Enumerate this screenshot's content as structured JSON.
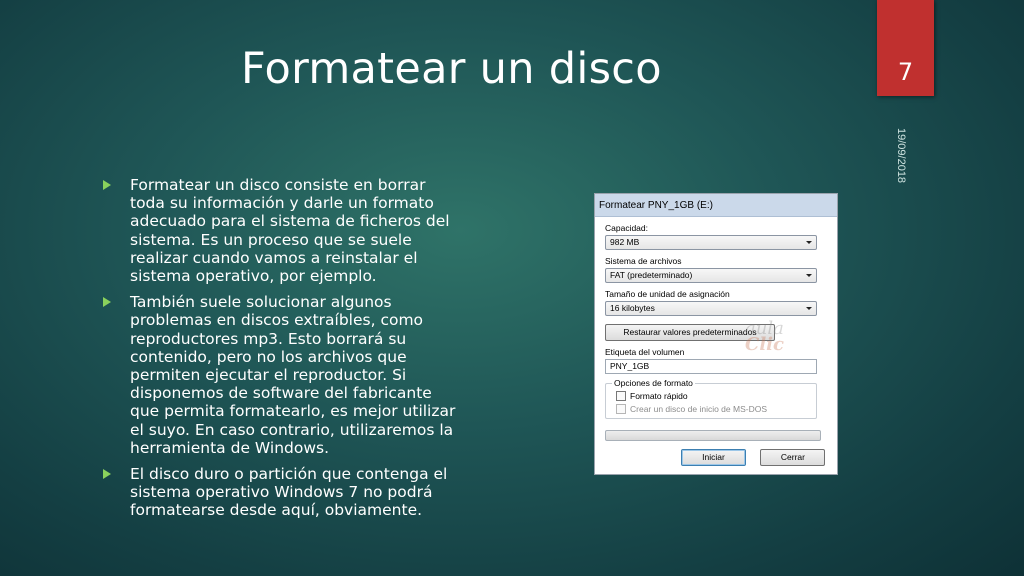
{
  "slide": {
    "title": "Formatear un disco",
    "page_number": "7",
    "date": "19/09/2018",
    "bullets": [
      "Formatear un disco consiste en borrar toda su información y darle un formato adecuado para el sistema de ficheros del sistema. Es un proceso que se suele realizar cuando vamos a reinstalar el sistema operativo, por ejemplo.",
      "También suele solucionar algunos problemas en discos extraíbles, como reproductores mp3. Esto borrará su contenido, pero no los archivos que permiten ejecutar el reproductor. Si disponemos de software del fabricante que permita formatearlo, es mejor utilizar el suyo. En caso contrario, utilizaremos la herramienta de Windows.",
      "El disco duro o partición que contenga el sistema operativo Windows 7 no podrá formatearse desde aquí, obviamente."
    ],
    "colors": {
      "accent_badge": "#c0302f",
      "bullet_marker": "#8ad15c"
    }
  },
  "dialog": {
    "title": "Formatear PNY_1GB (E:)",
    "capacity_label": "Capacidad:",
    "capacity_value": "982 MB",
    "filesystem_label": "Sistema de archivos",
    "filesystem_value": "FAT (predeterminado)",
    "allocation_label": "Tamaño de unidad de asignación",
    "allocation_value": "16 kilobytes",
    "restore_button": "Restaurar valores predeterminados",
    "volume_label": "Etiqueta del volumen",
    "volume_value": "PNY_1GB",
    "format_options_title": "Opciones de formato",
    "quick_format": "Formato rápido",
    "msdos_disk": "Crear un disco de inicio de MS-DOS",
    "progress_value": 0,
    "start_button": "Iniciar",
    "close_button": "Cerrar",
    "watermark_top": "aula",
    "watermark_bottom": "Clic"
  }
}
